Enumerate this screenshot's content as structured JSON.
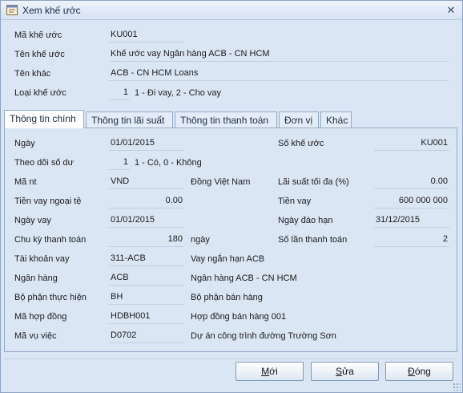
{
  "window": {
    "title": "Xem khế ước",
    "close_glyph": "✕"
  },
  "header": {
    "ma_ku": {
      "label": "Mã khế ước",
      "value": "KU001"
    },
    "ten_ku": {
      "label": "Tên khế ước",
      "value": "Khế ước vay Ngân hàng ACB - CN HCM"
    },
    "ten_khac": {
      "label": "Tên khác",
      "value": "ACB - CN HCM Loans"
    },
    "loai_ku": {
      "label": "Loại khế ước",
      "value": "1",
      "hint": "1 - Đi vay, 2 - Cho vay"
    }
  },
  "tabs": [
    {
      "label": "Thông tin chính",
      "active": true
    },
    {
      "label": "Thông tin lãi suất",
      "active": false
    },
    {
      "label": "Thông tin thanh toán",
      "active": false
    },
    {
      "label": "Đơn vị",
      "active": false
    },
    {
      "label": "Khác",
      "active": false
    }
  ],
  "main": {
    "ngay": {
      "label": "Ngày",
      "value": "01/01/2015"
    },
    "so_ku": {
      "label": "Số khế ước",
      "value": "KU001"
    },
    "theo_doi": {
      "label": "Theo dõi số dư",
      "value": "1",
      "hint": "1 - Có, 0 - Không"
    },
    "ma_nt": {
      "label": "Mã nt",
      "value": "VND",
      "desc": "Đồng Việt Nam"
    },
    "lai_suat": {
      "label": "Lãi suất tối đa (%)",
      "value": "0.00"
    },
    "tien_vay_nt": {
      "label": "Tiền vay ngoại tệ",
      "value": "0.00"
    },
    "tien_vay": {
      "label": "Tiền vay",
      "value": "600 000 000"
    },
    "ngay_vay": {
      "label": "Ngày vay",
      "value": "01/01/2015"
    },
    "ngay_dao_han": {
      "label": "Ngày đáo hạn",
      "value": "31/12/2015"
    },
    "chu_ky": {
      "label": "Chu kỳ thanh toán",
      "value": "180",
      "unit": "ngày"
    },
    "so_lan": {
      "label": "Số lần thanh toán",
      "value": "2"
    },
    "tk_vay": {
      "label": "Tài khoản vay",
      "value": "311-ACB",
      "desc": "Vay ngắn hạn ACB"
    },
    "ngan_hang": {
      "label": "Ngân hàng",
      "value": "ACB",
      "desc": "Ngân hàng ACB - CN HCM"
    },
    "bo_phan": {
      "label": "Bộ phận thực hiện",
      "value": "BH",
      "desc": "Bộ phận bán hàng"
    },
    "hop_dong": {
      "label": "Mã hợp đồng",
      "value": "HDBH001",
      "desc": "Hợp đồng bán hàng 001"
    },
    "vu_viec": {
      "label": "Mã vụ việc",
      "value": "D0702",
      "desc": "Dự án công trình đường Trường Sơn"
    }
  },
  "buttons": {
    "new": {
      "pre": "",
      "key": "M",
      "post": "ới"
    },
    "edit": {
      "pre": "",
      "key": "S",
      "post": "ửa"
    },
    "close": {
      "pre": "",
      "key": "Đ",
      "post": "óng"
    }
  }
}
